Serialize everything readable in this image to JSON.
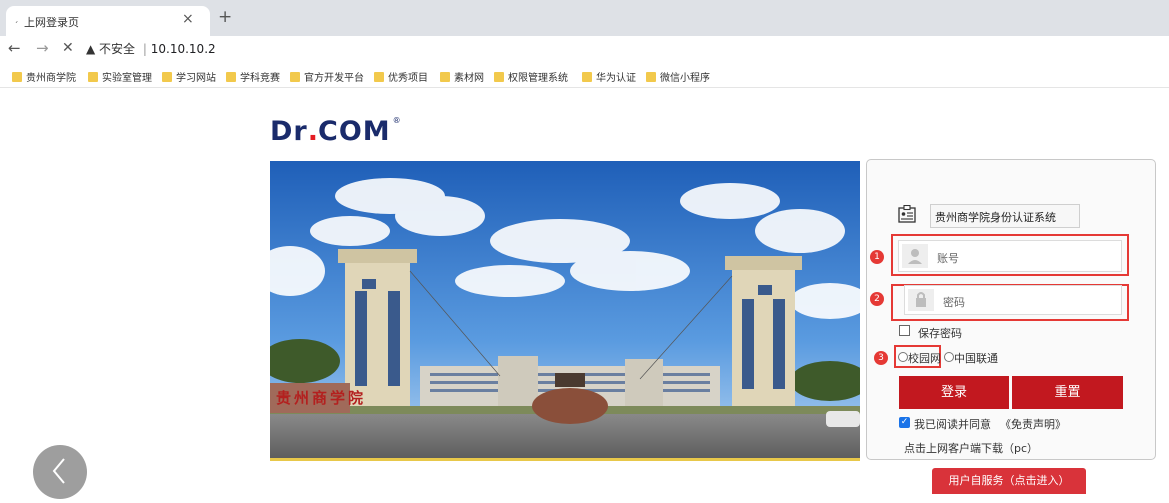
{
  "browser": {
    "tab_title": "上网登录页",
    "tab_close": "×",
    "new_tab": "+",
    "back": "←",
    "forward": "→",
    "reload_stop": "✕",
    "security_warning": "▲ 不安全",
    "url": "10.10.10.2"
  },
  "bookmarks": [
    {
      "label": "贵州商学院"
    },
    {
      "label": "实验室管理"
    },
    {
      "label": "学习网站"
    },
    {
      "label": "学科竞赛"
    },
    {
      "label": "官方开发平台"
    },
    {
      "label": "优秀项目"
    },
    {
      "label": "素材网"
    },
    {
      "label": "权限管理系统"
    },
    {
      "label": "华为认证"
    },
    {
      "label": "微信小程序"
    }
  ],
  "logo": {
    "text_a": "Dr",
    "dot": ".",
    "text_b": "COM",
    "reg": "®"
  },
  "login": {
    "system_name": "贵州商学院身份认证系统",
    "account_placeholder": "账号",
    "password_placeholder": "密码",
    "remember_password": "保存密码",
    "network_options": [
      "校园网",
      "中国联通"
    ],
    "login_button": "登录",
    "reset_button": "重置",
    "agree_text": "我已阅读并同意",
    "disclaimer_link": "《免责声明》",
    "download_text": "点击上网客户端下载（pc）",
    "self_service_button": "用户自服务（点击进入）",
    "markers": [
      "1",
      "2",
      "3"
    ]
  },
  "photo": {
    "caption": "贵州商学院"
  },
  "colors": {
    "accent_red": "#c2181f",
    "highlight_red": "#e53935",
    "logo_navy": "#1a2b6b"
  }
}
